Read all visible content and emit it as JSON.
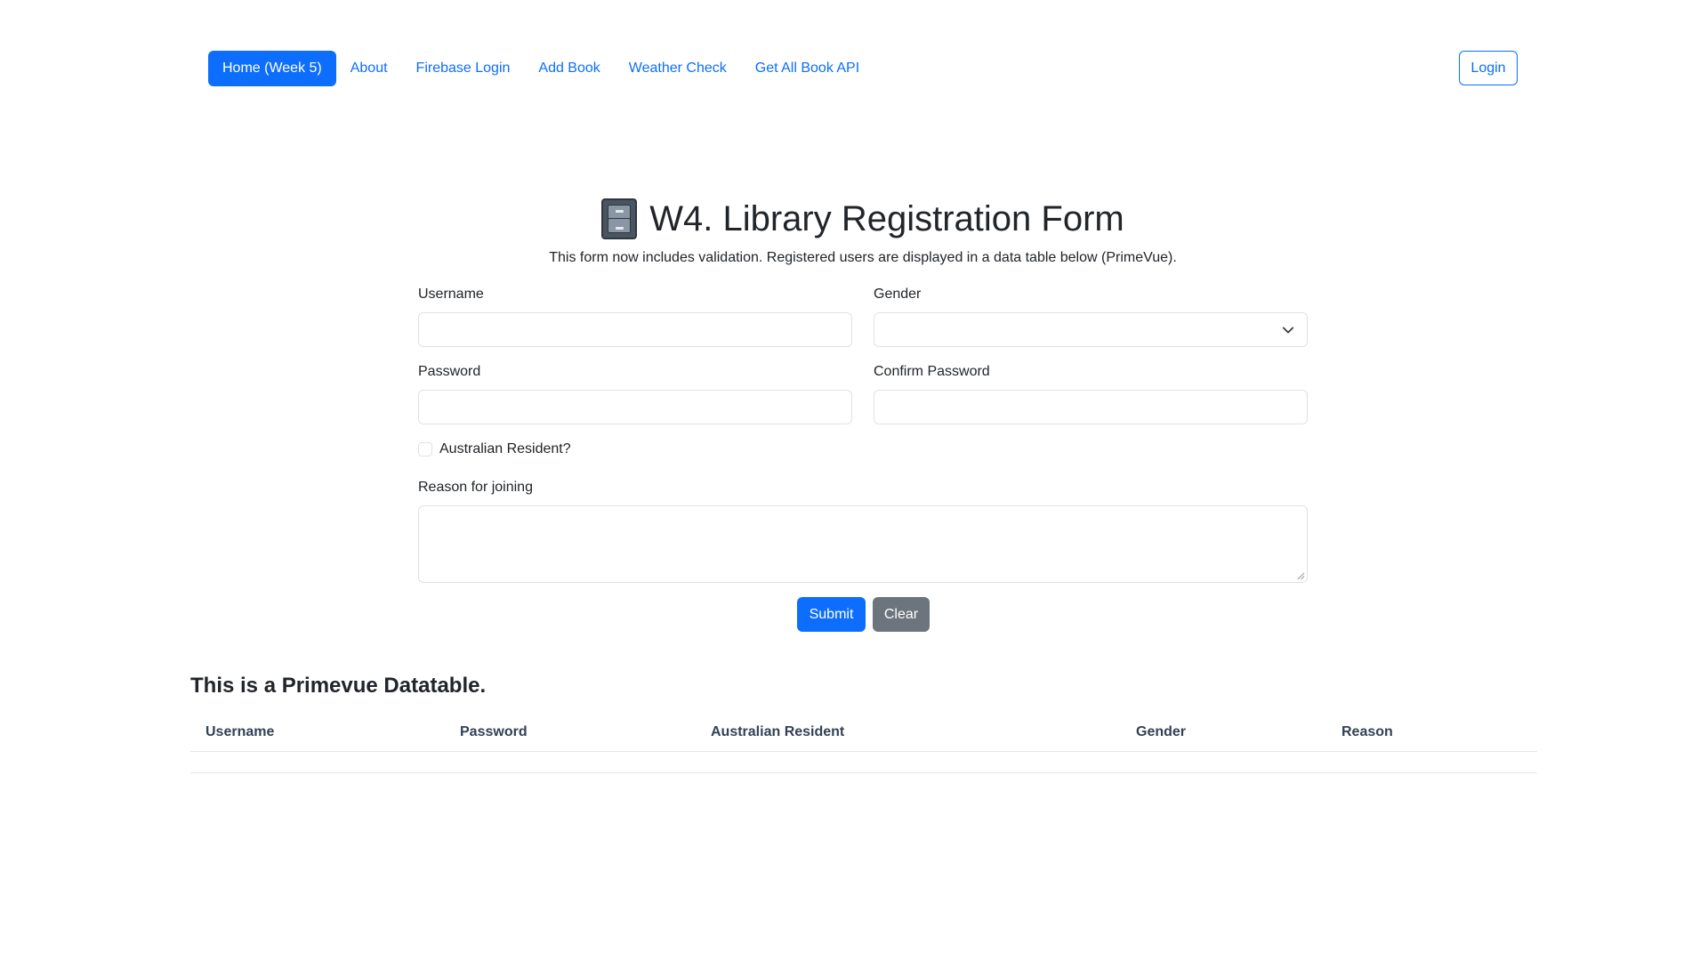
{
  "nav": {
    "items": [
      {
        "label": "Home (Week 5)",
        "active": true
      },
      {
        "label": "About"
      },
      {
        "label": "Firebase Login"
      },
      {
        "label": "Add Book"
      },
      {
        "label": "Weather Check"
      },
      {
        "label": "Get All Book API"
      }
    ],
    "login_label": "Login"
  },
  "header": {
    "icon": "file-cabinet-icon",
    "title": "W4. Library Registration Form",
    "subtitle": "This form now includes validation. Registered users are displayed in a data table below (PrimeVue)."
  },
  "form": {
    "username_label": "Username",
    "username_value": "",
    "gender_label": "Gender",
    "gender_value": "",
    "password_label": "Password",
    "password_value": "",
    "confirm_password_label": "Confirm Password",
    "confirm_password_value": "",
    "resident_label": "Australian Resident?",
    "resident_checked": false,
    "reason_label": "Reason for joining",
    "reason_value": "",
    "submit_label": "Submit",
    "clear_label": "Clear"
  },
  "table": {
    "heading": "This is a Primevue Datatable.",
    "columns": [
      "Username",
      "Password",
      "Australian Resident",
      "Gender",
      "Reason"
    ],
    "rows": []
  },
  "colors": {
    "primary": "#0d6efd",
    "secondary": "#6c757d",
    "border": "#dee2e6"
  }
}
